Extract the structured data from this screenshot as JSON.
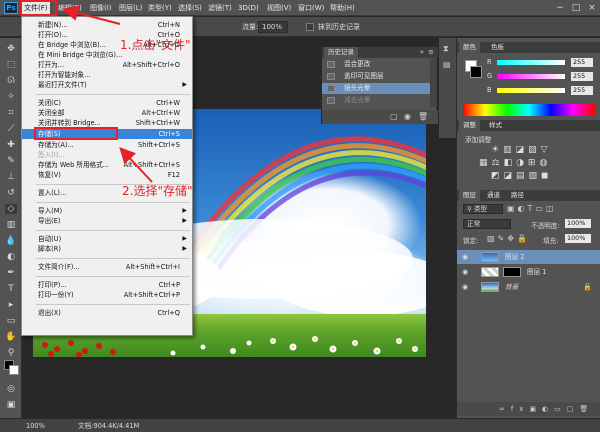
{
  "app": {
    "logo": "Ps"
  },
  "menubar": {
    "items": [
      "文件(F)",
      "编辑(E)",
      "图像(I)",
      "图层(L)",
      "类型(Y)",
      "选择(S)",
      "滤镜(T)",
      "3D(D)",
      "视图(V)",
      "窗口(W)",
      "帮助(H)"
    ],
    "win_min": "−",
    "win_max": "□",
    "win_close": "×"
  },
  "options": {
    "flow_label": "流量:",
    "flow_value": "100%",
    "history_label": "抹到历史记录"
  },
  "file_menu": {
    "items": [
      {
        "label": "新建(N)...",
        "shortcut": "Ctrl+N"
      },
      {
        "label": "打开(O)...",
        "shortcut": "Ctrl+O"
      },
      {
        "label": "在 Bridge 中浏览(B)...",
        "shortcut": "Alt+Ctrl+O"
      },
      {
        "label": "在 Mini Bridge 中浏览(G)...",
        "shortcut": ""
      },
      {
        "label": "打开为...",
        "shortcut": "Alt+Shift+Ctrl+O"
      },
      {
        "label": "打开为智能对象...",
        "shortcut": ""
      },
      {
        "label": "最近打开文件(T)",
        "shortcut": ""
      },
      {
        "label": "关闭(C)",
        "shortcut": "Ctrl+W"
      },
      {
        "label": "关闭全部",
        "shortcut": "Alt+Ctrl+W"
      },
      {
        "label": "关闭并转到 Bridge...",
        "shortcut": "Shift+Ctrl+W"
      },
      {
        "label": "存储(S)",
        "shortcut": "Ctrl+S"
      },
      {
        "label": "存储为(A)...",
        "shortcut": "Shift+Ctrl+S"
      },
      {
        "label": "签入(I)...",
        "shortcut": ""
      },
      {
        "label": "存储为 Web 所用格式...",
        "shortcut": "Alt+Shift+Ctrl+S"
      },
      {
        "label": "恢复(V)",
        "shortcut": "F12"
      },
      {
        "label": "置入(L)...",
        "shortcut": ""
      },
      {
        "label": "导入(M)",
        "shortcut": ""
      },
      {
        "label": "导出(E)",
        "shortcut": ""
      },
      {
        "label": "自动(U)",
        "shortcut": ""
      },
      {
        "label": "脚本(R)",
        "shortcut": ""
      },
      {
        "label": "文件简介(F)...",
        "shortcut": "Alt+Shift+Ctrl+I"
      },
      {
        "label": "打印(P)...",
        "shortcut": "Ctrl+P"
      },
      {
        "label": "打印一份(Y)",
        "shortcut": "Alt+Shift+Ctrl+P"
      },
      {
        "label": "退出(X)",
        "shortcut": "Ctrl+Q"
      }
    ]
  },
  "annotations": {
    "step1": "1.点击\"文件\"",
    "step2": "2.选择\"存储\""
  },
  "history": {
    "tab": "历史记录",
    "rows": [
      "混合更改",
      "盖印可见图层",
      "镜头光晕",
      "减去光晕"
    ]
  },
  "color_panel": {
    "tabs": [
      "颜色",
      "色板"
    ],
    "channels": [
      {
        "label": "R",
        "value": "255"
      },
      {
        "label": "G",
        "value": "255"
      },
      {
        "label": "B",
        "value": "255"
      }
    ]
  },
  "adjust_panel": {
    "tabs": [
      "调整",
      "样式"
    ],
    "title": "添加调整"
  },
  "layers_panel": {
    "tabs": [
      "图层",
      "通道",
      "路径"
    ],
    "kind": "类型",
    "blend": "正常",
    "opacity_label": "不透明度:",
    "opacity": "100%",
    "lock_label": "锁定:",
    "fill_label": "填充:",
    "fill": "100%",
    "layers": [
      {
        "name": "图层 2"
      },
      {
        "name": "图层 1"
      },
      {
        "name": "背景"
      }
    ]
  },
  "statusbar": {
    "zoom": "100%",
    "doc": "文档:904.4K/4.41M"
  }
}
